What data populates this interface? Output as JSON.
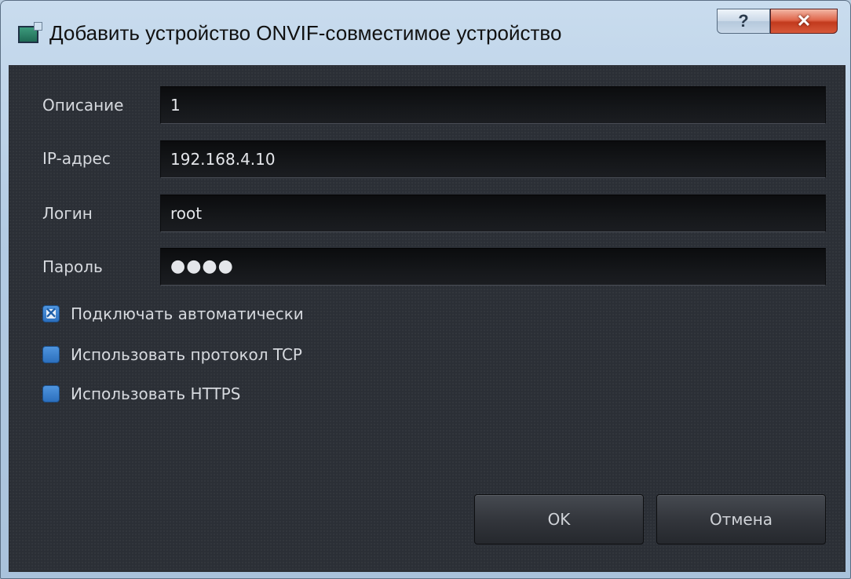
{
  "window": {
    "title": "Добавить устройство ONVIF-совместимое устройство",
    "help_label": "?",
    "close_label": "✕"
  },
  "form": {
    "description": {
      "label": "Описание",
      "value": "1"
    },
    "ip_address": {
      "label": "IP-адрес",
      "value": "192.168.4.10"
    },
    "login": {
      "label": "Логин",
      "value": "root"
    },
    "password": {
      "label": "Пароль",
      "masked_value": "●●●●"
    }
  },
  "options": [
    {
      "label": "Подключать автоматически",
      "checked": true
    },
    {
      "label": "Использовать протокол TCP",
      "checked": false
    },
    {
      "label": "Использовать HTTPS",
      "checked": false
    }
  ],
  "buttons": {
    "ok_label": "OK",
    "cancel_label": "Отмена"
  },
  "colors": {
    "panel_bg": "#2b2f36",
    "checkbox_blue": "#2c6fbd",
    "close_red": "#c23a1d"
  }
}
